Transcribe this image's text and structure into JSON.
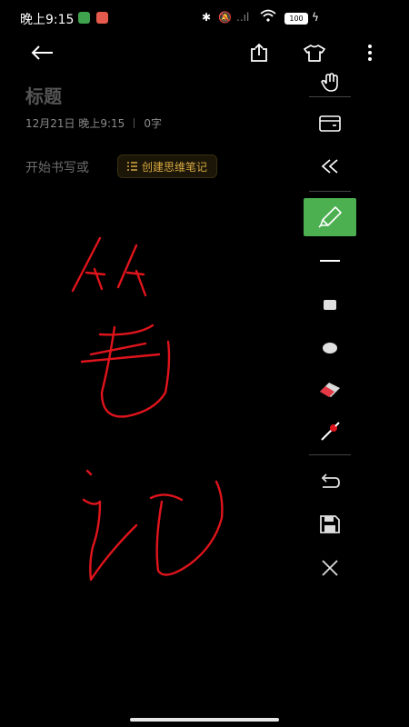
{
  "status_bar": {
    "time": "晚上9:15",
    "battery": "100",
    "signal_text": "..ıl"
  },
  "toolbar": {
    "back_icon": "arrow-left-icon",
    "share_icon": "share-icon",
    "theme_icon": "tshirt-icon",
    "more_icon": "more-vertical-icon"
  },
  "note": {
    "title_placeholder": "标题",
    "date": "12月21日 晚上9:15",
    "word_count": "0字",
    "body_placeholder": "开始书写或",
    "mind_map_button": "创建思维笔记"
  },
  "tools": [
    "hand-icon",
    "keyboard-icon",
    "collapse-icon",
    "pen-icon",
    "line-width-thin-icon",
    "line-width-medium-icon",
    "line-width-large-icon",
    "eraser-icon",
    "color-picker-icon",
    "undo-icon",
    "save-icon",
    "close-icon"
  ],
  "colors": {
    "active_tool": "#4caf50",
    "ink": "#e0141c",
    "accent": "#d7a941"
  }
}
